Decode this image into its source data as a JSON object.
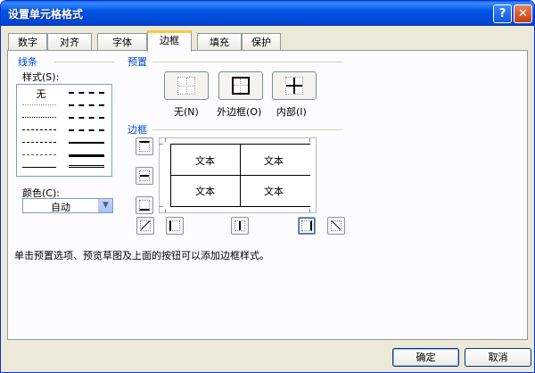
{
  "window": {
    "title": "设置单元格格式",
    "help_glyph": "?",
    "close_glyph": "✕"
  },
  "tabs": [
    {
      "label": "数字"
    },
    {
      "label": "对齐"
    },
    {
      "label": "字体"
    },
    {
      "label": "边框",
      "active": true
    },
    {
      "label": "填充"
    },
    {
      "label": "保护"
    }
  ],
  "line_group": {
    "title": "线条",
    "style_label": "样式(S):",
    "none_label": "无",
    "color_label": "颜色(C):",
    "color_value": "自动"
  },
  "presets": {
    "title": "预置",
    "none_label": "无(N)",
    "outline_label": "外边框(O)",
    "inside_label": "内部(I)"
  },
  "border": {
    "title": "边框",
    "preview_texts": [
      "文本",
      "文本",
      "文本",
      "文本"
    ]
  },
  "hint": "单击预置选项、预览草图及上面的按钮可以添加边框样式。",
  "buttons": {
    "ok": "确定",
    "cancel": "取消"
  },
  "colors": {
    "title_bar": "#0055e5",
    "group_title": "#0046d5",
    "dialog_bg": "#ece9d8",
    "active_tab_accent": "#ffc83c"
  }
}
